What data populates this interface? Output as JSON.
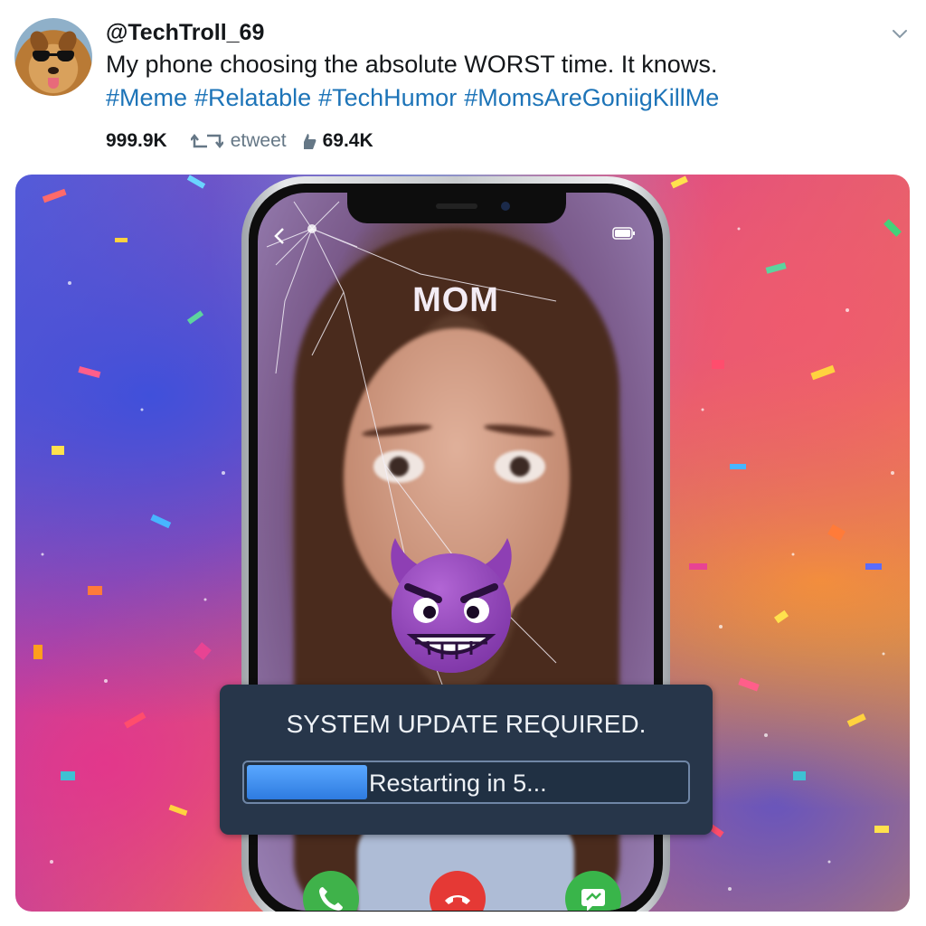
{
  "tweet": {
    "handle": "@TechTroll_69",
    "text": "My phone choosing the absolute WORST time. It knows.",
    "hashtags": [
      "#Meme",
      "#Relatable",
      "#TechHumor",
      "#MomsAreGoniigKillMe"
    ],
    "stats": {
      "count": "999.9K",
      "retweet_label": "etweet",
      "likes": "69.4K"
    }
  },
  "phone": {
    "caller_name": "MOM",
    "overlay": {
      "title": "SYSTEM UPDATE REQUIRED.",
      "progress_label": "Restarting in 5...",
      "progress_fraction": 0.27
    }
  },
  "colors": {
    "hashtag": "#1d74b8",
    "accept": "#3fb24a",
    "decline": "#e53935",
    "overlay_bg": "#27364a",
    "progress": "#2e7be0"
  },
  "icons": [
    "avatar",
    "chevron-down-icon",
    "retweet-icon",
    "like-icon",
    "back-icon",
    "battery-icon",
    "devil-emoji-icon",
    "phone-icon",
    "hang-up-icon",
    "message-icon"
  ]
}
